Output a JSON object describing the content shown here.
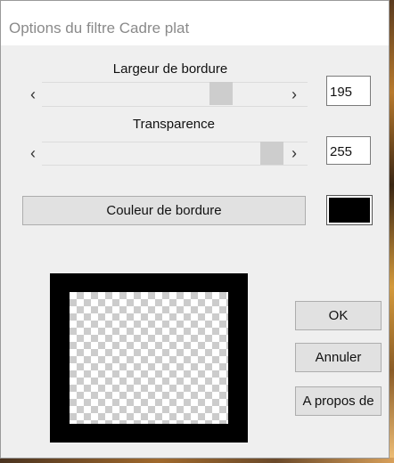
{
  "window": {
    "title": "Options du filtre Cadre plat"
  },
  "sliders": [
    {
      "label": "Largeur de bordure",
      "value": "195",
      "left_arrow": "‹",
      "right_arrow": "›"
    },
    {
      "label": "Transparence",
      "value": "255",
      "left_arrow": "‹",
      "right_arrow": "›"
    }
  ],
  "color": {
    "button_label": "Couleur de bordure",
    "swatch_color": "#000000"
  },
  "buttons": {
    "ok": "OK",
    "cancel": "Annuler",
    "about": "A propos de"
  },
  "preview": {
    "frame_color": "#000000",
    "transparency_pattern": "checkerboard"
  }
}
